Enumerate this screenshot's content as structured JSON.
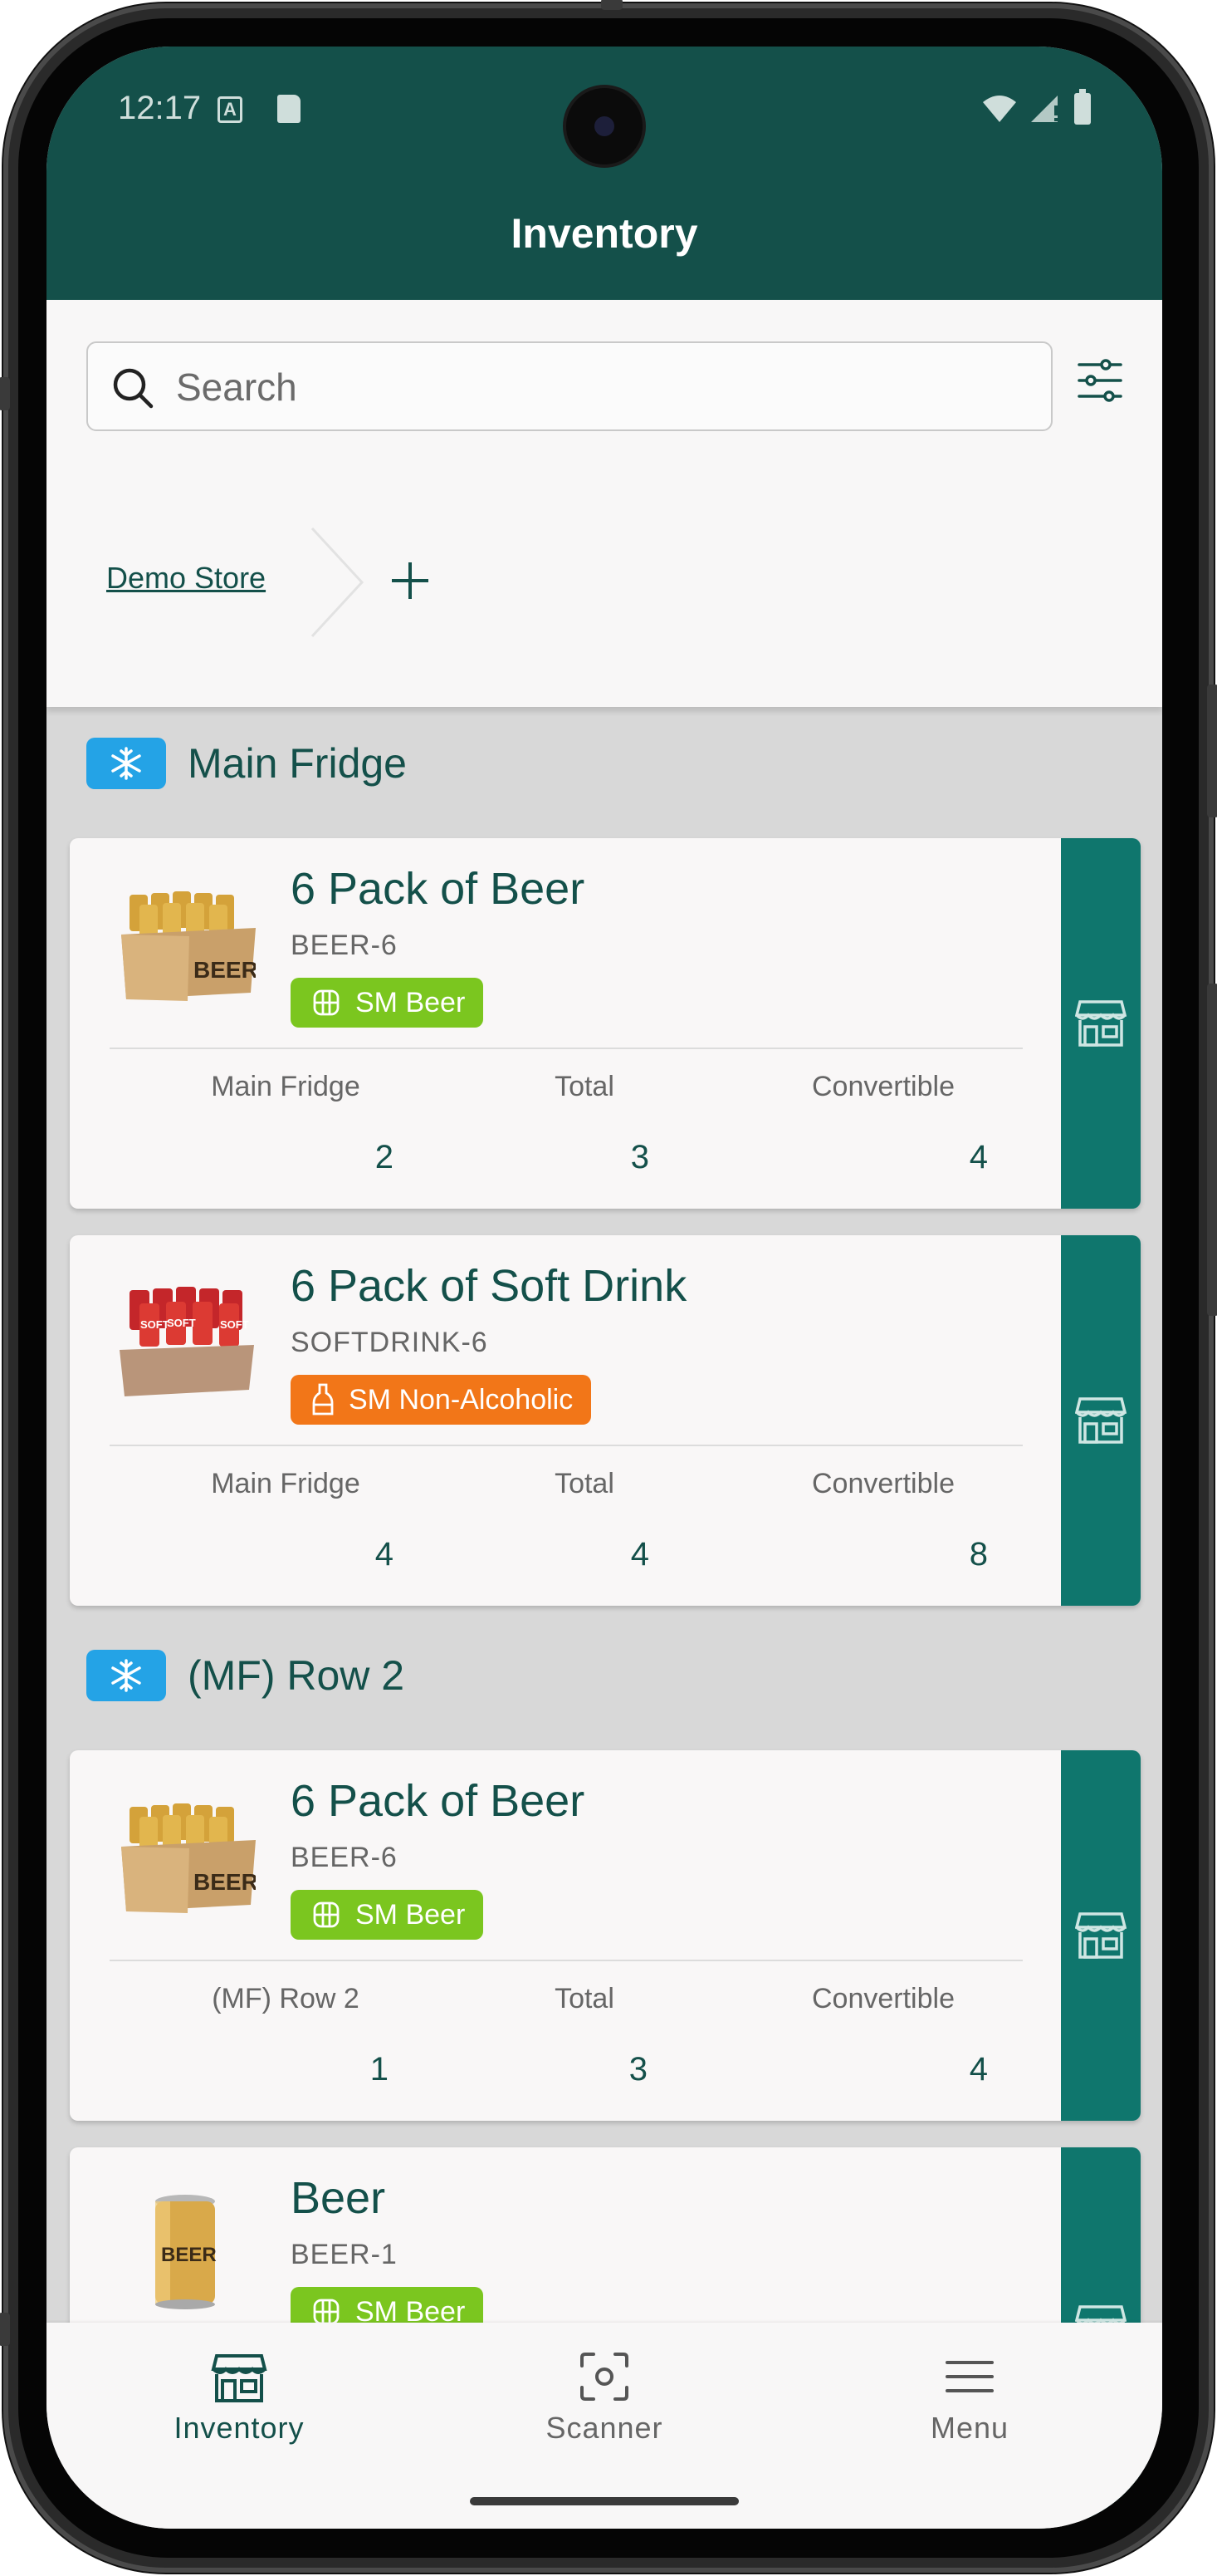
{
  "status_bar": {
    "time": "12:17",
    "a_badge": "A"
  },
  "app_bar": {
    "title": "Inventory"
  },
  "search": {
    "placeholder": "Search",
    "value": ""
  },
  "breadcrumb": {
    "items": [
      "Demo Store"
    ]
  },
  "sections": [
    {
      "title": "Main Fridge",
      "icon": "snowflake-icon",
      "cards": [
        {
          "name": "6 Pack of Beer",
          "sku": "BEER-6",
          "tag": "SM Beer",
          "tag_color": "#7bc61f",
          "tag_icon": "globe-icon",
          "image": "beer-six-pack",
          "stats": {
            "location_label": "Main Fridge",
            "location_value": "2",
            "total_label": "Total",
            "total_value": "3",
            "convertible_label": "Convertible",
            "convertible_value": "4"
          }
        },
        {
          "name": "6 Pack of Soft Drink",
          "sku": "SOFTDRINK-6",
          "tag": "SM Non-Alcoholic",
          "tag_color": "#f27618",
          "tag_icon": "bottle-icon",
          "image": "soft-drink-six-pack",
          "stats": {
            "location_label": "Main Fridge",
            "location_value": "4",
            "total_label": "Total",
            "total_value": "4",
            "convertible_label": "Convertible",
            "convertible_value": "8"
          }
        }
      ]
    },
    {
      "title": "(MF) Row 2",
      "icon": "snowflake-icon",
      "cards": [
        {
          "name": "6 Pack of Beer",
          "sku": "BEER-6",
          "tag": "SM Beer",
          "tag_color": "#7bc61f",
          "tag_icon": "globe-icon",
          "image": "beer-six-pack",
          "stats": {
            "location_label": "(MF) Row 2",
            "location_value": "1",
            "total_label": "Total",
            "total_value": "3",
            "convertible_label": "Convertible",
            "convertible_value": "4"
          }
        },
        {
          "name": "Beer",
          "sku": "BEER-1",
          "tag": "SM Beer",
          "tag_color": "#7bc61f",
          "tag_icon": "globe-icon",
          "image": "beer-can"
        }
      ]
    }
  ],
  "colors": {
    "header": "#14504a",
    "accent": "#0f766d",
    "fridge_badge": "#24a3e6"
  },
  "bottom_nav": {
    "items": [
      {
        "label": "Inventory",
        "icon": "store-icon",
        "active": true
      },
      {
        "label": "Scanner",
        "icon": "scan-icon",
        "active": false
      },
      {
        "label": "Menu",
        "icon": "menu-icon",
        "active": false
      }
    ]
  }
}
